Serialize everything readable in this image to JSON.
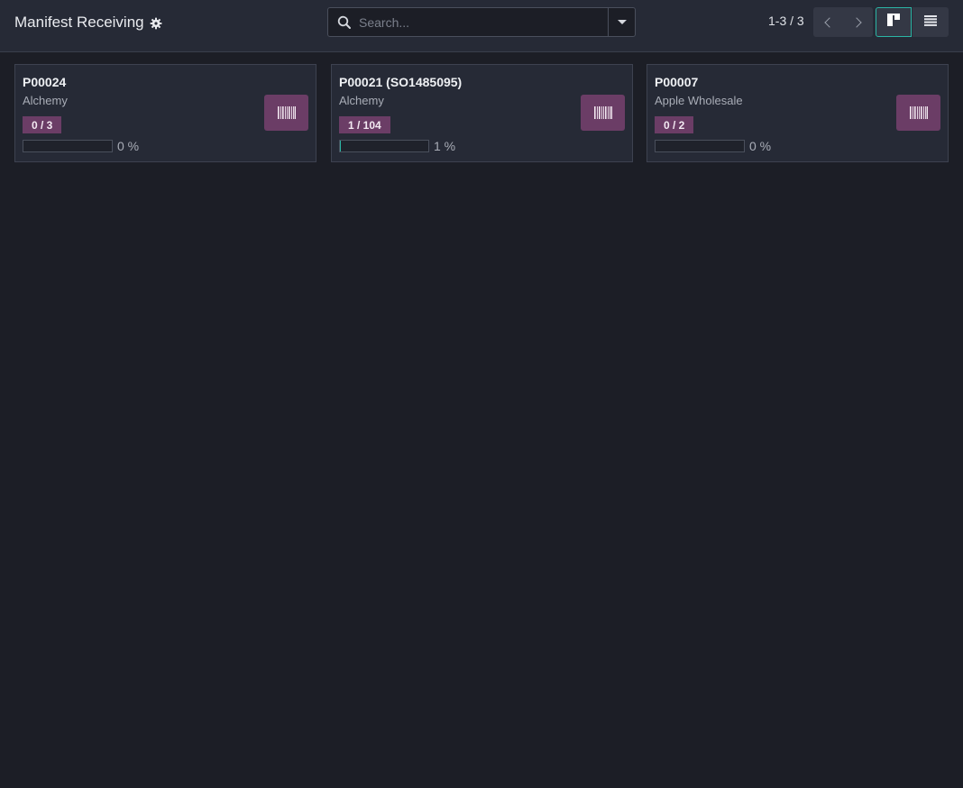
{
  "header": {
    "title": "Manifest Receiving",
    "search_placeholder": "Search...",
    "search_value": "",
    "pager_text": "1-3 / 3"
  },
  "cards": [
    {
      "title": "P00024",
      "partner": "Alchemy",
      "badge": "0 / 3",
      "progress": 0,
      "progress_label": "0 %"
    },
    {
      "title": "P00021 (SO1485095)",
      "partner": "Alchemy",
      "badge": "1 / 104",
      "progress": 1,
      "progress_label": "1 %"
    },
    {
      "title": "P00007",
      "partner": "Apple Wholesale",
      "badge": "0 / 2",
      "progress": 0,
      "progress_label": "0 %"
    }
  ],
  "icons": {
    "gear": "gear-icon",
    "search": "search-icon",
    "dropdown": "caret-down-icon",
    "prev": "chevron-left-icon",
    "next": "chevron-right-icon",
    "kanban_view": "kanban-view-icon",
    "list_view": "list-view-icon",
    "barcode": "barcode-icon"
  },
  "colors": {
    "background": "#1c1e26",
    "panel": "#262a36",
    "accent": "#2bb5a5",
    "badge": "#6b3d66"
  }
}
